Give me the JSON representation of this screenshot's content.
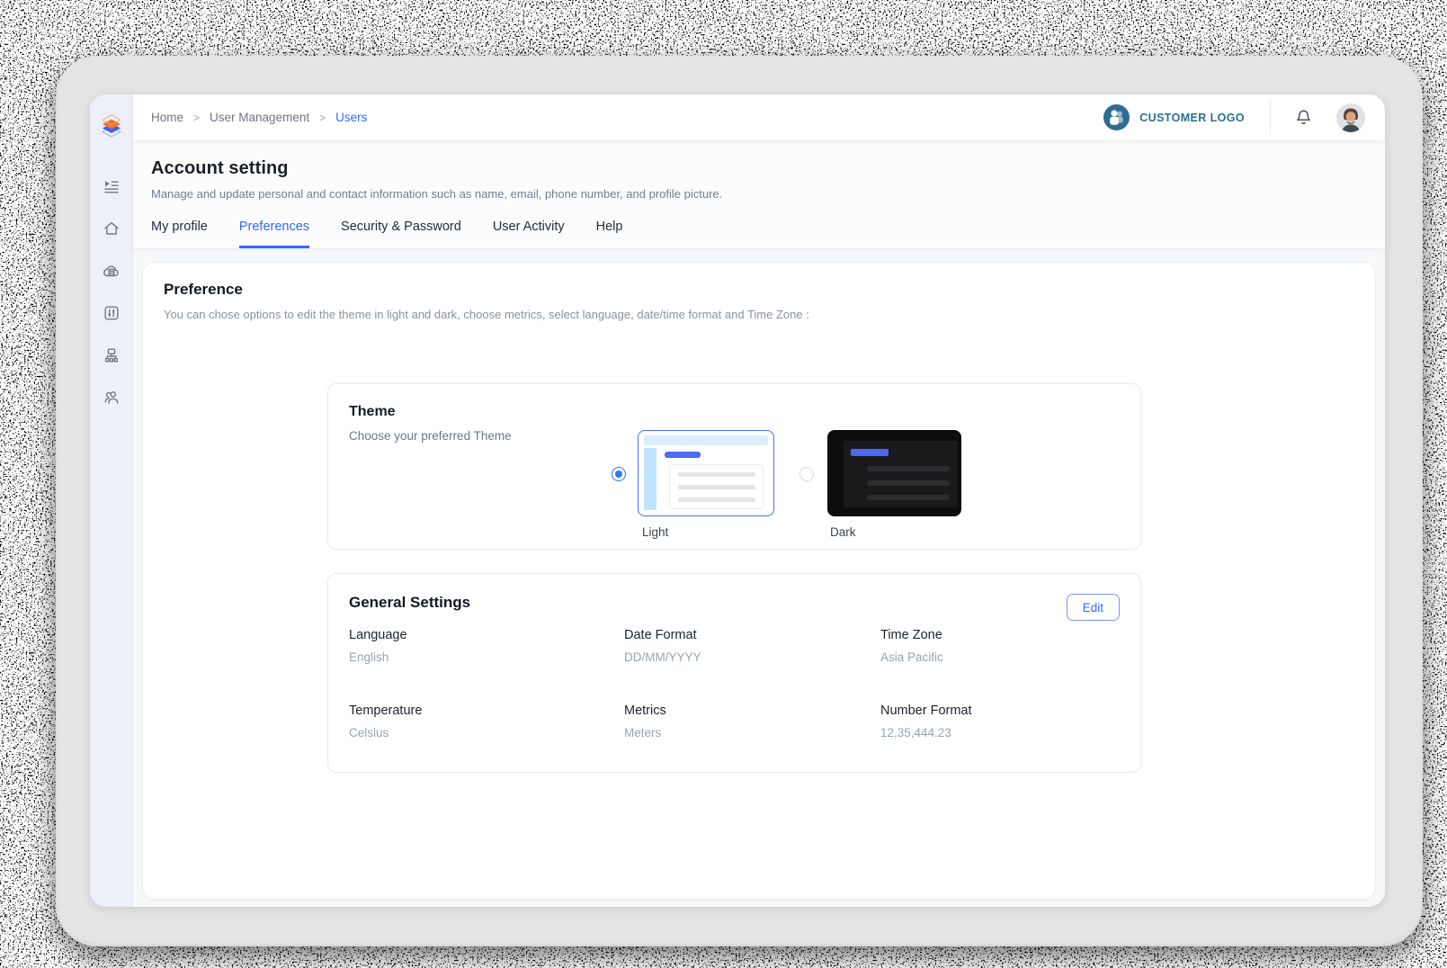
{
  "breadcrumb": {
    "separator": ">",
    "items": [
      {
        "label": "Home"
      },
      {
        "label": "User Management"
      },
      {
        "label": "Users"
      }
    ]
  },
  "topbar": {
    "customer_logo_label": "CUSTOMER LOGO"
  },
  "page": {
    "title": "Account setting",
    "subtitle": "Manage and update personal and contact information such as name, email, phone number, and profile picture."
  },
  "tabs": {
    "items": [
      {
        "label": "My profile",
        "active": false
      },
      {
        "label": "Preferences",
        "active": true
      },
      {
        "label": "Security & Password",
        "active": false
      },
      {
        "label": "User Activity",
        "active": false
      },
      {
        "label": "Help",
        "active": false
      }
    ]
  },
  "preference": {
    "title": "Preference",
    "description": "You can chose options to edit the theme in light and dark, choose metrics, select language, date/time format and Time Zone :"
  },
  "theme": {
    "title": "Theme",
    "subtitle": "Choose your preferred Theme",
    "options": [
      {
        "label": "Light",
        "selected": true
      },
      {
        "label": "Dark",
        "selected": false
      }
    ]
  },
  "general_settings": {
    "title": "General Settings",
    "edit_label": "Edit",
    "fields": [
      {
        "label": "Language",
        "value": "English"
      },
      {
        "label": "Date Format",
        "value": "DD/MM/YYYY"
      },
      {
        "label": "Time Zone",
        "value": "Asia Pacific"
      },
      {
        "label": "Temperature",
        "value": "Celsius"
      },
      {
        "label": "Metrics",
        "value": "Meters"
      },
      {
        "label": "Number Format",
        "value": "12,35,444.23"
      }
    ]
  },
  "sidebar": {
    "icons": [
      "collapse-menu",
      "home",
      "cloud-database",
      "preferences-sliders",
      "org-chart",
      "users"
    ]
  },
  "colors": {
    "accent_blue": "#2f6bf6",
    "theme_preview_blue": "#4a6cf7",
    "brand_teal": "#2d6e90",
    "logo_orange": "#f4741f",
    "logo_blue": "#3b63f6",
    "sidebar_bg": "#edf0f8",
    "bezel_gray": "#e4e4e5",
    "content_bg": "#f7f8fa"
  }
}
